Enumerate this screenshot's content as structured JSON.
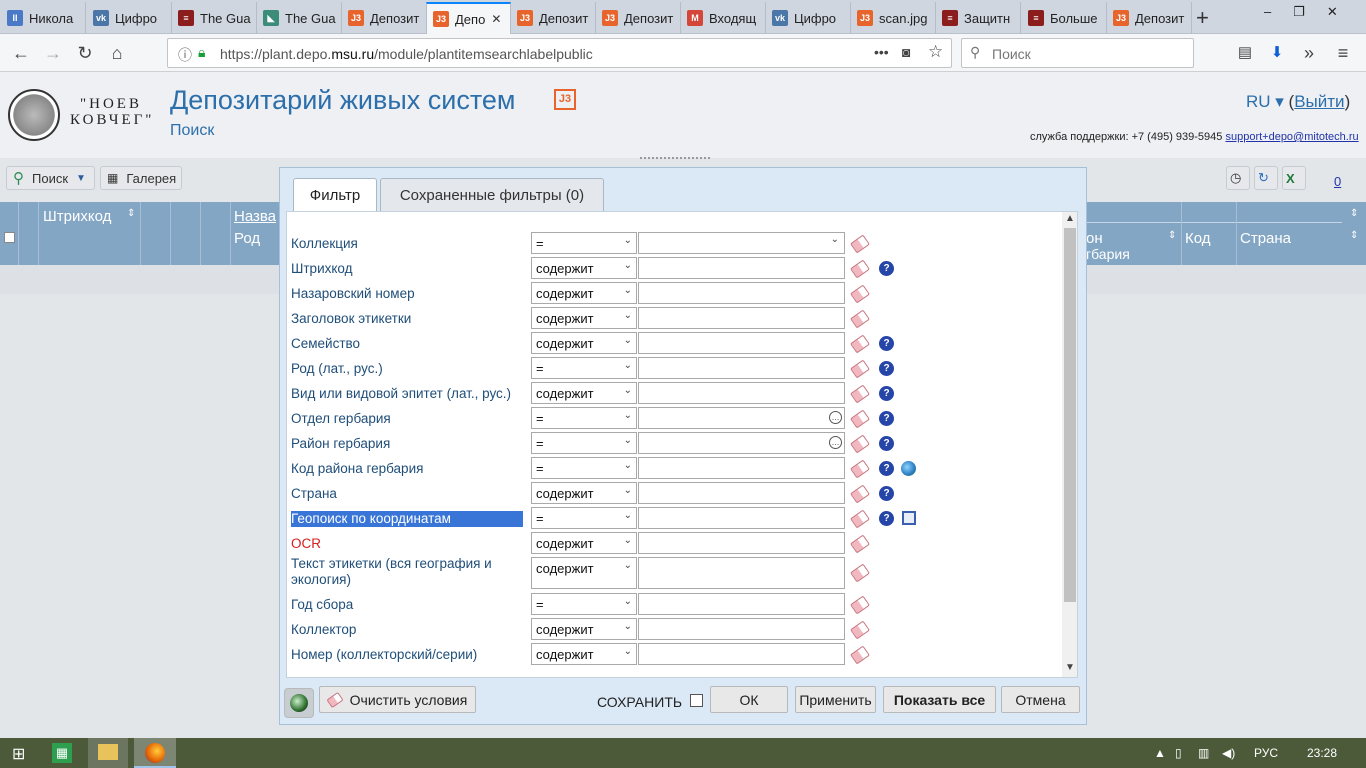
{
  "browser": {
    "tabs": [
      {
        "label": "Никола",
        "icon": "blue-pause-icon",
        "color": "#4a79c8",
        "glyph": "II"
      },
      {
        "label": "Цифро",
        "icon": "vk-icon",
        "color": "#4a76a8",
        "glyph": "vk"
      },
      {
        "label": "The Gua",
        "icon": "guardian-icon",
        "color": "#8b1d1d",
        "glyph": "≡"
      },
      {
        "label": "The Gua",
        "icon": "guardian-green-icon",
        "color": "#3b8d7a",
        "glyph": "◣"
      },
      {
        "label": "Депозит",
        "icon": "j3-icon",
        "color": "#e7652d",
        "glyph": "J3"
      },
      {
        "label": "Депо",
        "icon": "j3-icon",
        "color": "#e7652d",
        "glyph": "J3"
      },
      {
        "label": "Депозит",
        "icon": "j3-icon",
        "color": "#e7652d",
        "glyph": "J3"
      },
      {
        "label": "Депозит",
        "icon": "j3-icon",
        "color": "#e7652d",
        "glyph": "J3"
      },
      {
        "label": "Входящ",
        "icon": "gmail-icon",
        "color": "#d44638",
        "glyph": "M"
      },
      {
        "label": "Цифро",
        "icon": "vk-icon",
        "color": "#4a76a8",
        "glyph": "vk"
      },
      {
        "label": "scan.jpg",
        "icon": "j3-icon",
        "color": "#e7652d",
        "glyph": "J3"
      },
      {
        "label": "Защитн",
        "icon": "news-icon",
        "color": "#8b1d1d",
        "glyph": "≡"
      },
      {
        "label": "Больше",
        "icon": "news-icon",
        "color": "#8b1d1d",
        "glyph": "≡"
      },
      {
        "label": "Депозит",
        "icon": "j3-icon",
        "color": "#e7652d",
        "glyph": "J3"
      }
    ],
    "new_tab": "+",
    "url_prefix": "https://plant.depo.",
    "url_domain": "msu.ru",
    "url_path": "/module/plantitemsearchlabelpublic",
    "search_placeholder": "Поиск"
  },
  "header": {
    "logo_line1": "\"НОЕВ",
    "logo_line2": "КОВЧЕГ\"",
    "title": "Депозитарий живых систем",
    "badge": "J3",
    "subtitle": "Поиск",
    "lang": "RU ▾",
    "logout_open": "(",
    "logout": "Выйти",
    "logout_close": ")",
    "support_label": "служба поддержки: +7 (495) 939-5945",
    "support_email": "support+depo@mitotech.ru"
  },
  "toolbar": {
    "search_label": "Поиск",
    "gallery_label": "Галерея",
    "count": "0"
  },
  "grid": {
    "columns": [
      "Штрихкод",
      "Назва",
      "Род",
      "он",
      "гбария",
      "Код",
      "Страна"
    ]
  },
  "dialog": {
    "tab_filter": "Фильтр",
    "tab_saved": "Сохраненные фильтры (0)",
    "fields": [
      {
        "label": "Коллекция",
        "op": "=",
        "value": "",
        "help": false
      },
      {
        "label": "Штрихкод",
        "op": "содержит",
        "value": "",
        "help": true
      },
      {
        "label": "Назаровский номер",
        "op": "содержит",
        "value": "",
        "help": false
      },
      {
        "label": "Заголовок этикетки",
        "op": "содержит",
        "value": "",
        "help": false
      },
      {
        "label": "Семейство",
        "op": "содержит",
        "value": "",
        "help": true
      },
      {
        "label": "Род (лат., рус.)",
        "op": "=",
        "value": "",
        "help": true
      },
      {
        "label": "Вид или видовой эпитет (лат., рус.)",
        "op": "содержит",
        "value": "",
        "help": true
      },
      {
        "label": "Отдел гербария",
        "op": "=",
        "value": "",
        "help": true
      },
      {
        "label": "Район гербария",
        "op": "=",
        "value": "",
        "help": true
      },
      {
        "label": "Код района гербария",
        "op": "=",
        "value": "",
        "help": true
      },
      {
        "label": "Страна",
        "op": "содержит",
        "value": "",
        "help": true
      },
      {
        "label": "Геопоиск по координатам",
        "op": "=",
        "value": "",
        "help": true
      },
      {
        "label": "OCR",
        "op": "содержит",
        "value": "",
        "help": false
      },
      {
        "label": "Текст этикетки (вся география и экология)",
        "op": "содержит",
        "value": "",
        "help": false
      },
      {
        "label": "Год сбора",
        "op": "=",
        "value": "",
        "help": false
      },
      {
        "label": "Коллектор",
        "op": "содержит",
        "value": "",
        "help": false
      },
      {
        "label": "Номер (коллекторский/серии)",
        "op": "содержит",
        "value": "",
        "help": false
      }
    ],
    "clear_label": "Очистить условия",
    "save_label": "СОХРАНИТЬ",
    "ok_label": "ОК",
    "apply_label": "Применить",
    "show_all_label": "Показать все",
    "cancel_label": "Отмена"
  },
  "taskbar": {
    "lang": "РУС",
    "time": "23:28"
  }
}
